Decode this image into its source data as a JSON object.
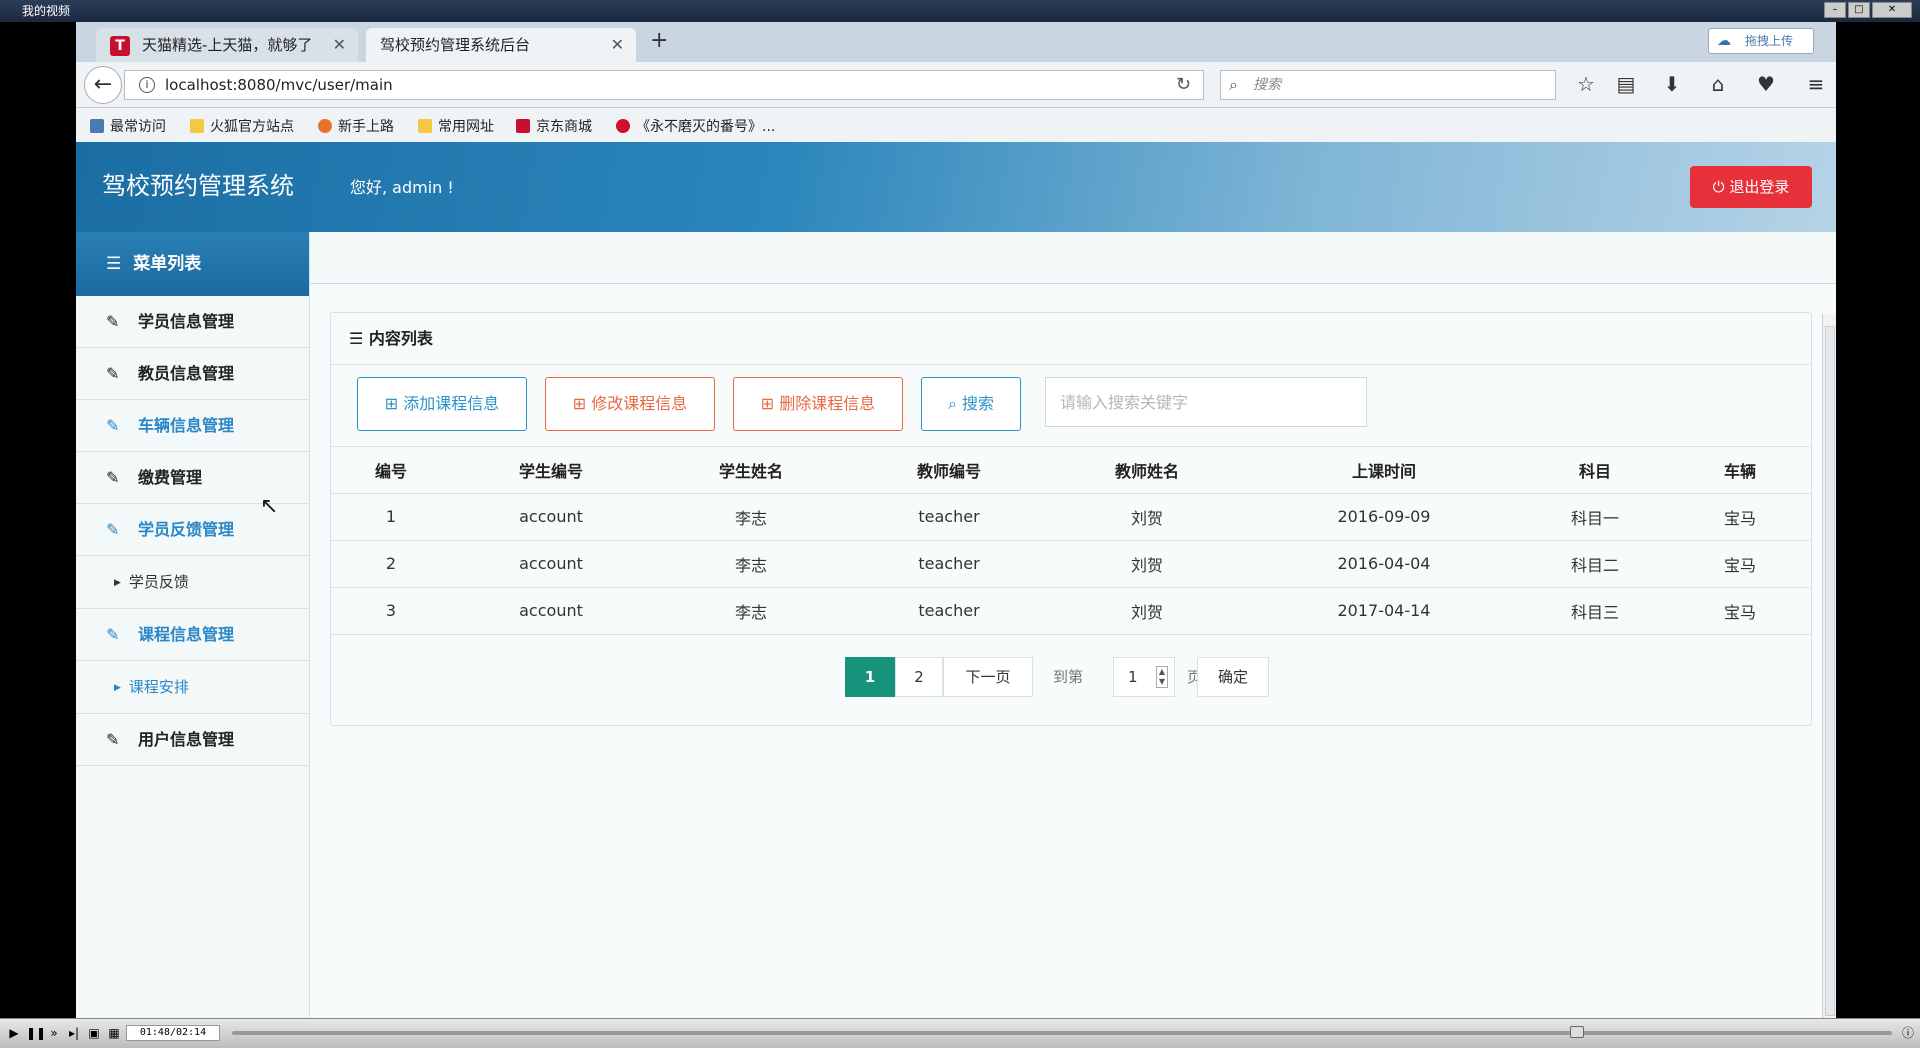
{
  "player": {
    "title": "我的视频",
    "time": "01:48/02:14",
    "progress": 0.81
  },
  "browser": {
    "tabs": [
      {
        "label": "天猫精选-上天猫，就够了",
        "icon": "T"
      },
      {
        "label": "驾校预约管理系统后台"
      }
    ],
    "new_tab": "+",
    "url": "localhost:8080/mvc/user/main",
    "search_placeholder": "搜索",
    "bookmarks": [
      "最常访问",
      "火狐官方站点",
      "新手上路",
      "常用网址",
      "京东商城",
      "《永不磨灭的番号》..."
    ],
    "upload_label": "拖拽上传"
  },
  "app": {
    "title": "驾校预约管理系统",
    "greeting": "您好, admin !",
    "logout": "退出登录",
    "menu_head": "菜单列表",
    "menu": [
      {
        "label": "学员信息管理",
        "active": false
      },
      {
        "label": "教员信息管理",
        "active": false
      },
      {
        "label": "车辆信息管理",
        "active": true
      },
      {
        "label": "缴费管理",
        "active": false
      },
      {
        "label": "学员反馈管理",
        "active": true
      },
      {
        "label": "学员反馈",
        "sub": true
      },
      {
        "label": "课程信息管理",
        "active": true
      },
      {
        "label": "课程安排",
        "sub": true,
        "active": true
      },
      {
        "label": "用户信息管理",
        "active": false
      }
    ],
    "panel_title": "内容列表",
    "buttons": {
      "add": "添加课程信息",
      "edit": "修改课程信息",
      "delete": "删除课程信息",
      "search": "搜索"
    },
    "search_placeholder": "请输入搜索关键字",
    "table": {
      "columns": [
        "编号",
        "学生编号",
        "学生姓名",
        "教师编号",
        "教师姓名",
        "上课时间",
        "科目",
        "车辆"
      ],
      "rows": [
        [
          "1",
          "account",
          "李志",
          "teacher",
          "刘贺",
          "2016-09-09",
          "科目一",
          "宝马"
        ],
        [
          "2",
          "account",
          "李志",
          "teacher",
          "刘贺",
          "2016-04-04",
          "科目二",
          "宝马"
        ],
        [
          "3",
          "account",
          "李志",
          "teacher",
          "刘贺",
          "2017-04-14",
          "科目三",
          "宝马"
        ]
      ]
    },
    "pager": {
      "pages": [
        "1",
        "2"
      ],
      "current": "1",
      "next": "下一页",
      "goto_prefix": "到第",
      "goto_value": "1",
      "goto_suffix": "页",
      "confirm": "确定"
    }
  },
  "colors": {
    "accent_blue": "#2b94c8",
    "danger": "#e8303a",
    "orange": "#e86a43",
    "pager_active": "#17927b"
  }
}
